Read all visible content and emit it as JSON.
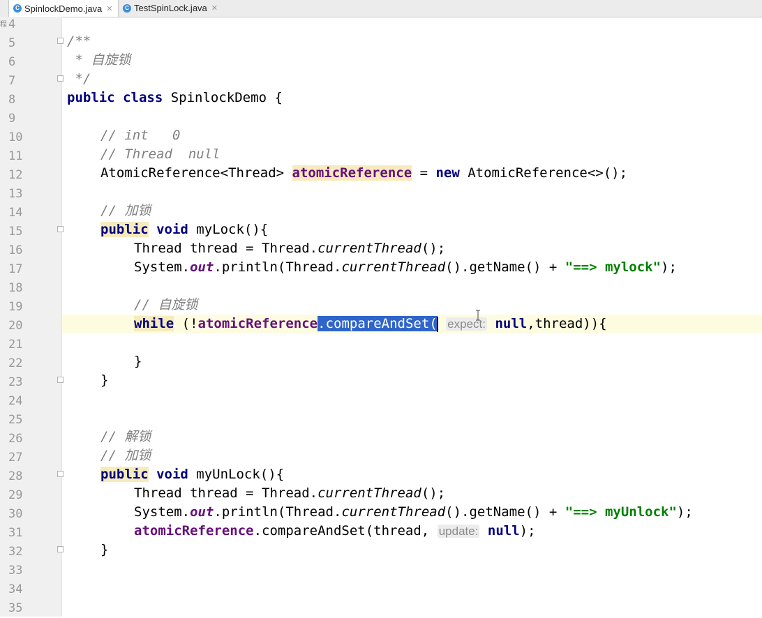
{
  "tabs": [
    {
      "label": "SpinlockDemo.java",
      "icon": "C",
      "active": true
    },
    {
      "label": "TestSpinLock.java",
      "icon": "C",
      "active": false
    }
  ],
  "gutter": {
    "side_char": "程"
  },
  "lines": {
    "l4": "4",
    "l5": "5",
    "l6": "6",
    "l7": "7",
    "l8": "8",
    "l9": "9",
    "l10": "10",
    "l11": "11",
    "l12": "12",
    "l13": "13",
    "l14": "14",
    "l15": "15",
    "l16": "16",
    "l17": "17",
    "l18": "18",
    "l19": "19",
    "l20": "20",
    "l21": "21",
    "l22": "22",
    "l23": "23",
    "l24": "24",
    "l25": "25",
    "l26": "26",
    "l27": "27",
    "l28": "28",
    "l29": "29",
    "l30": "30",
    "l31": "31",
    "l32": "32",
    "l33": "33",
    "l34": "34",
    "l35": "35"
  },
  "code": {
    "c5": "/**",
    "c6": " * 自旋锁",
    "c7": " */",
    "c8_kw1": "public",
    "c8_kw2": "class",
    "c8_rest": " SpinlockDemo {",
    "c10": "// int   0",
    "c11": "// Thread  null",
    "c12_a": "AtomicReference<Thread> ",
    "c12_fld": "atomicReference",
    "c12_b": " = ",
    "c12_kw": "new",
    "c12_c": " AtomicReference<>();",
    "c14": "// 加锁",
    "c15_kw1": "public",
    "c15_kw2": "void",
    "c15_rest": " myLock(){",
    "c16_a": "Thread thread = Thread.",
    "c16_i": "currentThread",
    "c16_b": "();",
    "c17_a": "System.",
    "c17_out": "out",
    "c17_b": ".println(Thread.",
    "c17_i": "currentThread",
    "c17_c": "().getName() + ",
    "c17_str": "\"==> mylock\"",
    "c17_d": ");",
    "c19": "// 自旋锁",
    "c20_kw": "while",
    "c20_a": " (!",
    "c20_fld": "atomicReference",
    "c20_sel": ".compareAndSet(",
    "c20_hint": "expect:",
    "c20_kw2": "null",
    "c20_b": ",thread)){",
    "c22": "}",
    "c23": "}",
    "c26": "// 解锁",
    "c27": "// 加锁",
    "c28_kw1": "public",
    "c28_kw2": "void",
    "c28_rest": " myUnLock(){",
    "c29_a": "Thread thread = Thread.",
    "c29_i": "currentThread",
    "c29_b": "();",
    "c30_a": "System.",
    "c30_out": "out",
    "c30_b": ".println(Thread.",
    "c30_i": "currentThread",
    "c30_c": "().getName() + ",
    "c30_str": "\"==> myUnlock\"",
    "c30_d": ");",
    "c31_fld": "atomicReference",
    "c31_a": ".compareAndSet(thread, ",
    "c31_hint": "update:",
    "c31_kw": "null",
    "c31_b": ");",
    "c32": "}"
  },
  "colors": {
    "keyword": "#000080",
    "comment": "#808080",
    "field": "#660e7a",
    "string": "#008000",
    "selection": "#2f65ca"
  },
  "icons": {
    "bulb": "lightbulb-icon",
    "tab": "java-class-icon",
    "close": "close-icon"
  }
}
